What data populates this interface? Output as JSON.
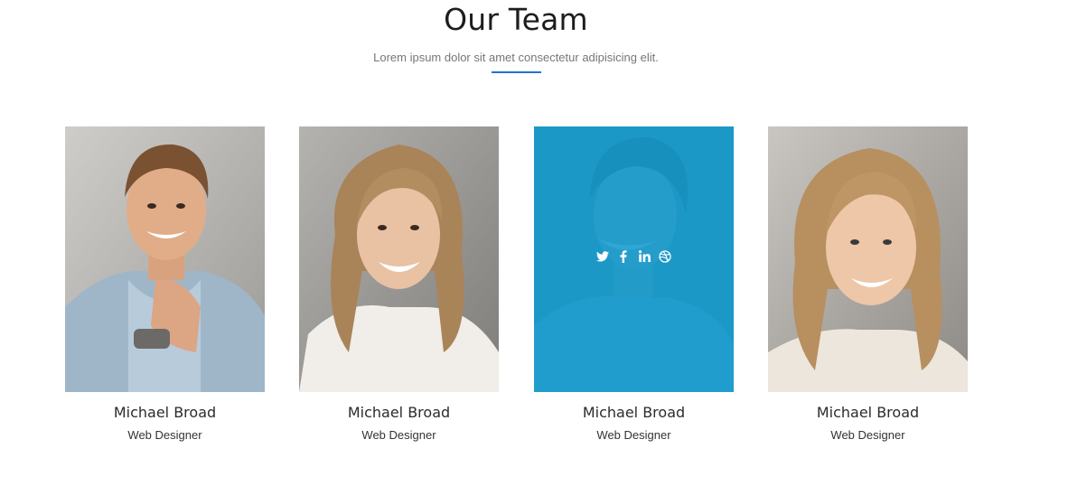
{
  "header": {
    "title": "Our Team",
    "subtitle": "Lorem ipsum dolor sit amet consectetur adipisicing elit."
  },
  "accent_color": "#1e74d4",
  "overlay_color": "#129ed4",
  "members": [
    {
      "name": "Michael Broad",
      "role": "Web Designer"
    },
    {
      "name": "Michael Broad",
      "role": "Web Designer"
    },
    {
      "name": "Michael Broad",
      "role": "Web Designer"
    },
    {
      "name": "Michael Broad",
      "role": "Web Designer"
    }
  ],
  "social_icons": [
    "twitter-icon",
    "facebook-icon",
    "linkedin-icon",
    "dribbble-icon"
  ]
}
